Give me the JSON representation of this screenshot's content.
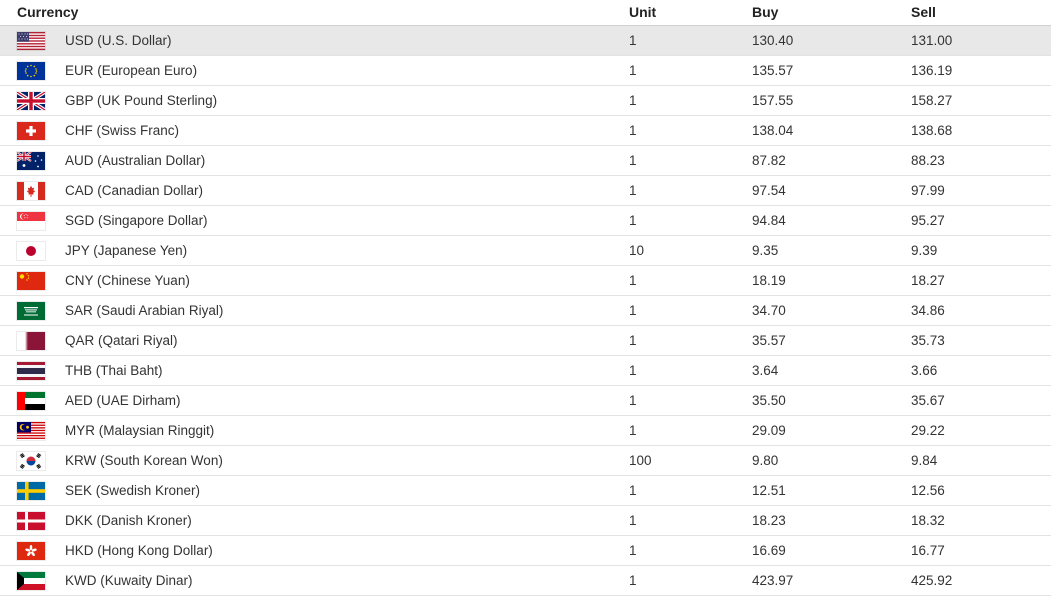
{
  "table": {
    "headers": {
      "currency": "Currency",
      "unit": "Unit",
      "buy": "Buy",
      "sell": "Sell"
    },
    "rows": [
      {
        "code": "USD",
        "name": "USD (U.S. Dollar)",
        "unit": "1",
        "buy": "130.40",
        "sell": "131.00",
        "flag_icon": "us-flag-icon",
        "selected": true
      },
      {
        "code": "EUR",
        "name": "EUR (European Euro)",
        "unit": "1",
        "buy": "135.57",
        "sell": "136.19",
        "flag_icon": "eu-flag-icon"
      },
      {
        "code": "GBP",
        "name": "GBP (UK Pound Sterling)",
        "unit": "1",
        "buy": "157.55",
        "sell": "158.27",
        "flag_icon": "uk-flag-icon"
      },
      {
        "code": "CHF",
        "name": "CHF (Swiss Franc)",
        "unit": "1",
        "buy": "138.04",
        "sell": "138.68",
        "flag_icon": "swiss-flag-icon"
      },
      {
        "code": "AUD",
        "name": "AUD (Australian Dollar)",
        "unit": "1",
        "buy": "87.82",
        "sell": "88.23",
        "flag_icon": "australia-flag-icon"
      },
      {
        "code": "CAD",
        "name": "CAD (Canadian Dollar)",
        "unit": "1",
        "buy": "97.54",
        "sell": "97.99",
        "flag_icon": "canada-flag-icon"
      },
      {
        "code": "SGD",
        "name": "SGD (Singapore Dollar)",
        "unit": "1",
        "buy": "94.84",
        "sell": "95.27",
        "flag_icon": "singapore-flag-icon"
      },
      {
        "code": "JPY",
        "name": "JPY (Japanese Yen)",
        "unit": "10",
        "buy": "9.35",
        "sell": "9.39",
        "flag_icon": "japan-flag-icon"
      },
      {
        "code": "CNY",
        "name": "CNY (Chinese Yuan)",
        "unit": "1",
        "buy": "18.19",
        "sell": "18.27",
        "flag_icon": "china-flag-icon"
      },
      {
        "code": "SAR",
        "name": "SAR (Saudi Arabian Riyal)",
        "unit": "1",
        "buy": "34.70",
        "sell": "34.86",
        "flag_icon": "saudi-flag-icon"
      },
      {
        "code": "QAR",
        "name": "QAR (Qatari Riyal)",
        "unit": "1",
        "buy": "35.57",
        "sell": "35.73",
        "flag_icon": "qatar-flag-icon"
      },
      {
        "code": "THB",
        "name": "THB (Thai Baht)",
        "unit": "1",
        "buy": "3.64",
        "sell": "3.66",
        "flag_icon": "thailand-flag-icon"
      },
      {
        "code": "AED",
        "name": "AED (UAE Dirham)",
        "unit": "1",
        "buy": "35.50",
        "sell": "35.67",
        "flag_icon": "uae-flag-icon"
      },
      {
        "code": "MYR",
        "name": "MYR (Malaysian Ringgit)",
        "unit": "1",
        "buy": "29.09",
        "sell": "29.22",
        "flag_icon": "malaysia-flag-icon"
      },
      {
        "code": "KRW",
        "name": "KRW (South Korean Won)",
        "unit": "100",
        "buy": "9.80",
        "sell": "9.84",
        "flag_icon": "south-korea-flag-icon"
      },
      {
        "code": "SEK",
        "name": "SEK (Swedish Kroner)",
        "unit": "1",
        "buy": "12.51",
        "sell": "12.56",
        "flag_icon": "sweden-flag-icon"
      },
      {
        "code": "DKK",
        "name": "DKK (Danish Kroner)",
        "unit": "1",
        "buy": "18.23",
        "sell": "18.32",
        "flag_icon": "denmark-flag-icon"
      },
      {
        "code": "HKD",
        "name": "HKD (Hong Kong Dollar)",
        "unit": "1",
        "buy": "16.69",
        "sell": "16.77",
        "flag_icon": "hong-kong-flag-icon"
      },
      {
        "code": "KWD",
        "name": "KWD (Kuwaity Dinar)",
        "unit": "1",
        "buy": "423.97",
        "sell": "425.92",
        "flag_icon": "kuwait-flag-icon"
      }
    ]
  },
  "colors": {
    "selected_row": "#e8e8e8",
    "divider": "#e3e3e3",
    "text": "#333333"
  }
}
